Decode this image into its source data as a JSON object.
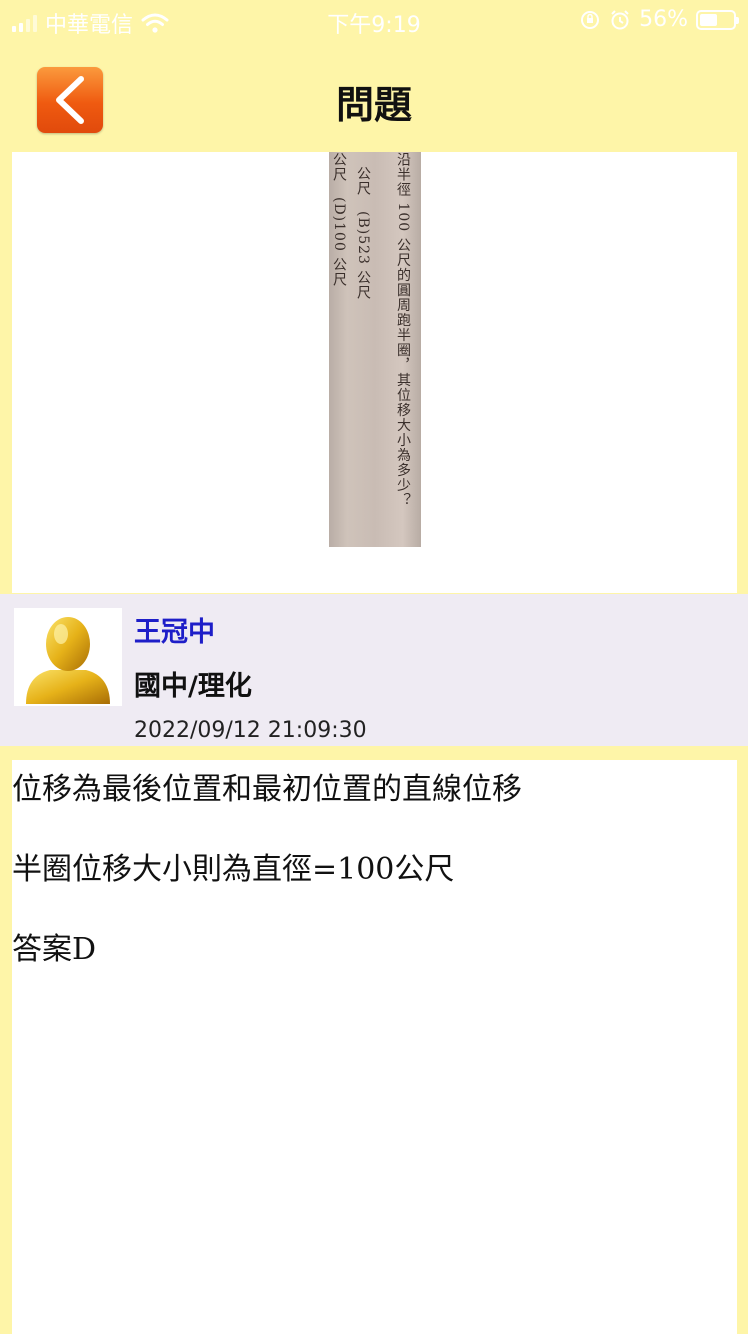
{
  "status_bar": {
    "carrier": "中華電信",
    "time": "下午9:19",
    "battery": "56%",
    "battery_level": 0.56
  },
  "nav": {
    "title": "問題"
  },
  "question": {
    "photo_text": [
      "沿半徑 100 公尺的圓周跑半圈，其位移大小為多少？",
      "公尺　(B)523 公尺",
      "公尺　(D)100 公尺"
    ]
  },
  "author": {
    "name": "王冠中",
    "subject": "國中/理化",
    "timestamp": "2022/09/12 21:09:30"
  },
  "answer": {
    "lines": [
      "位移為最後位置和最初位置的直線位移",
      "半圈位移大小則為直徑=100公尺",
      "答案D"
    ]
  }
}
